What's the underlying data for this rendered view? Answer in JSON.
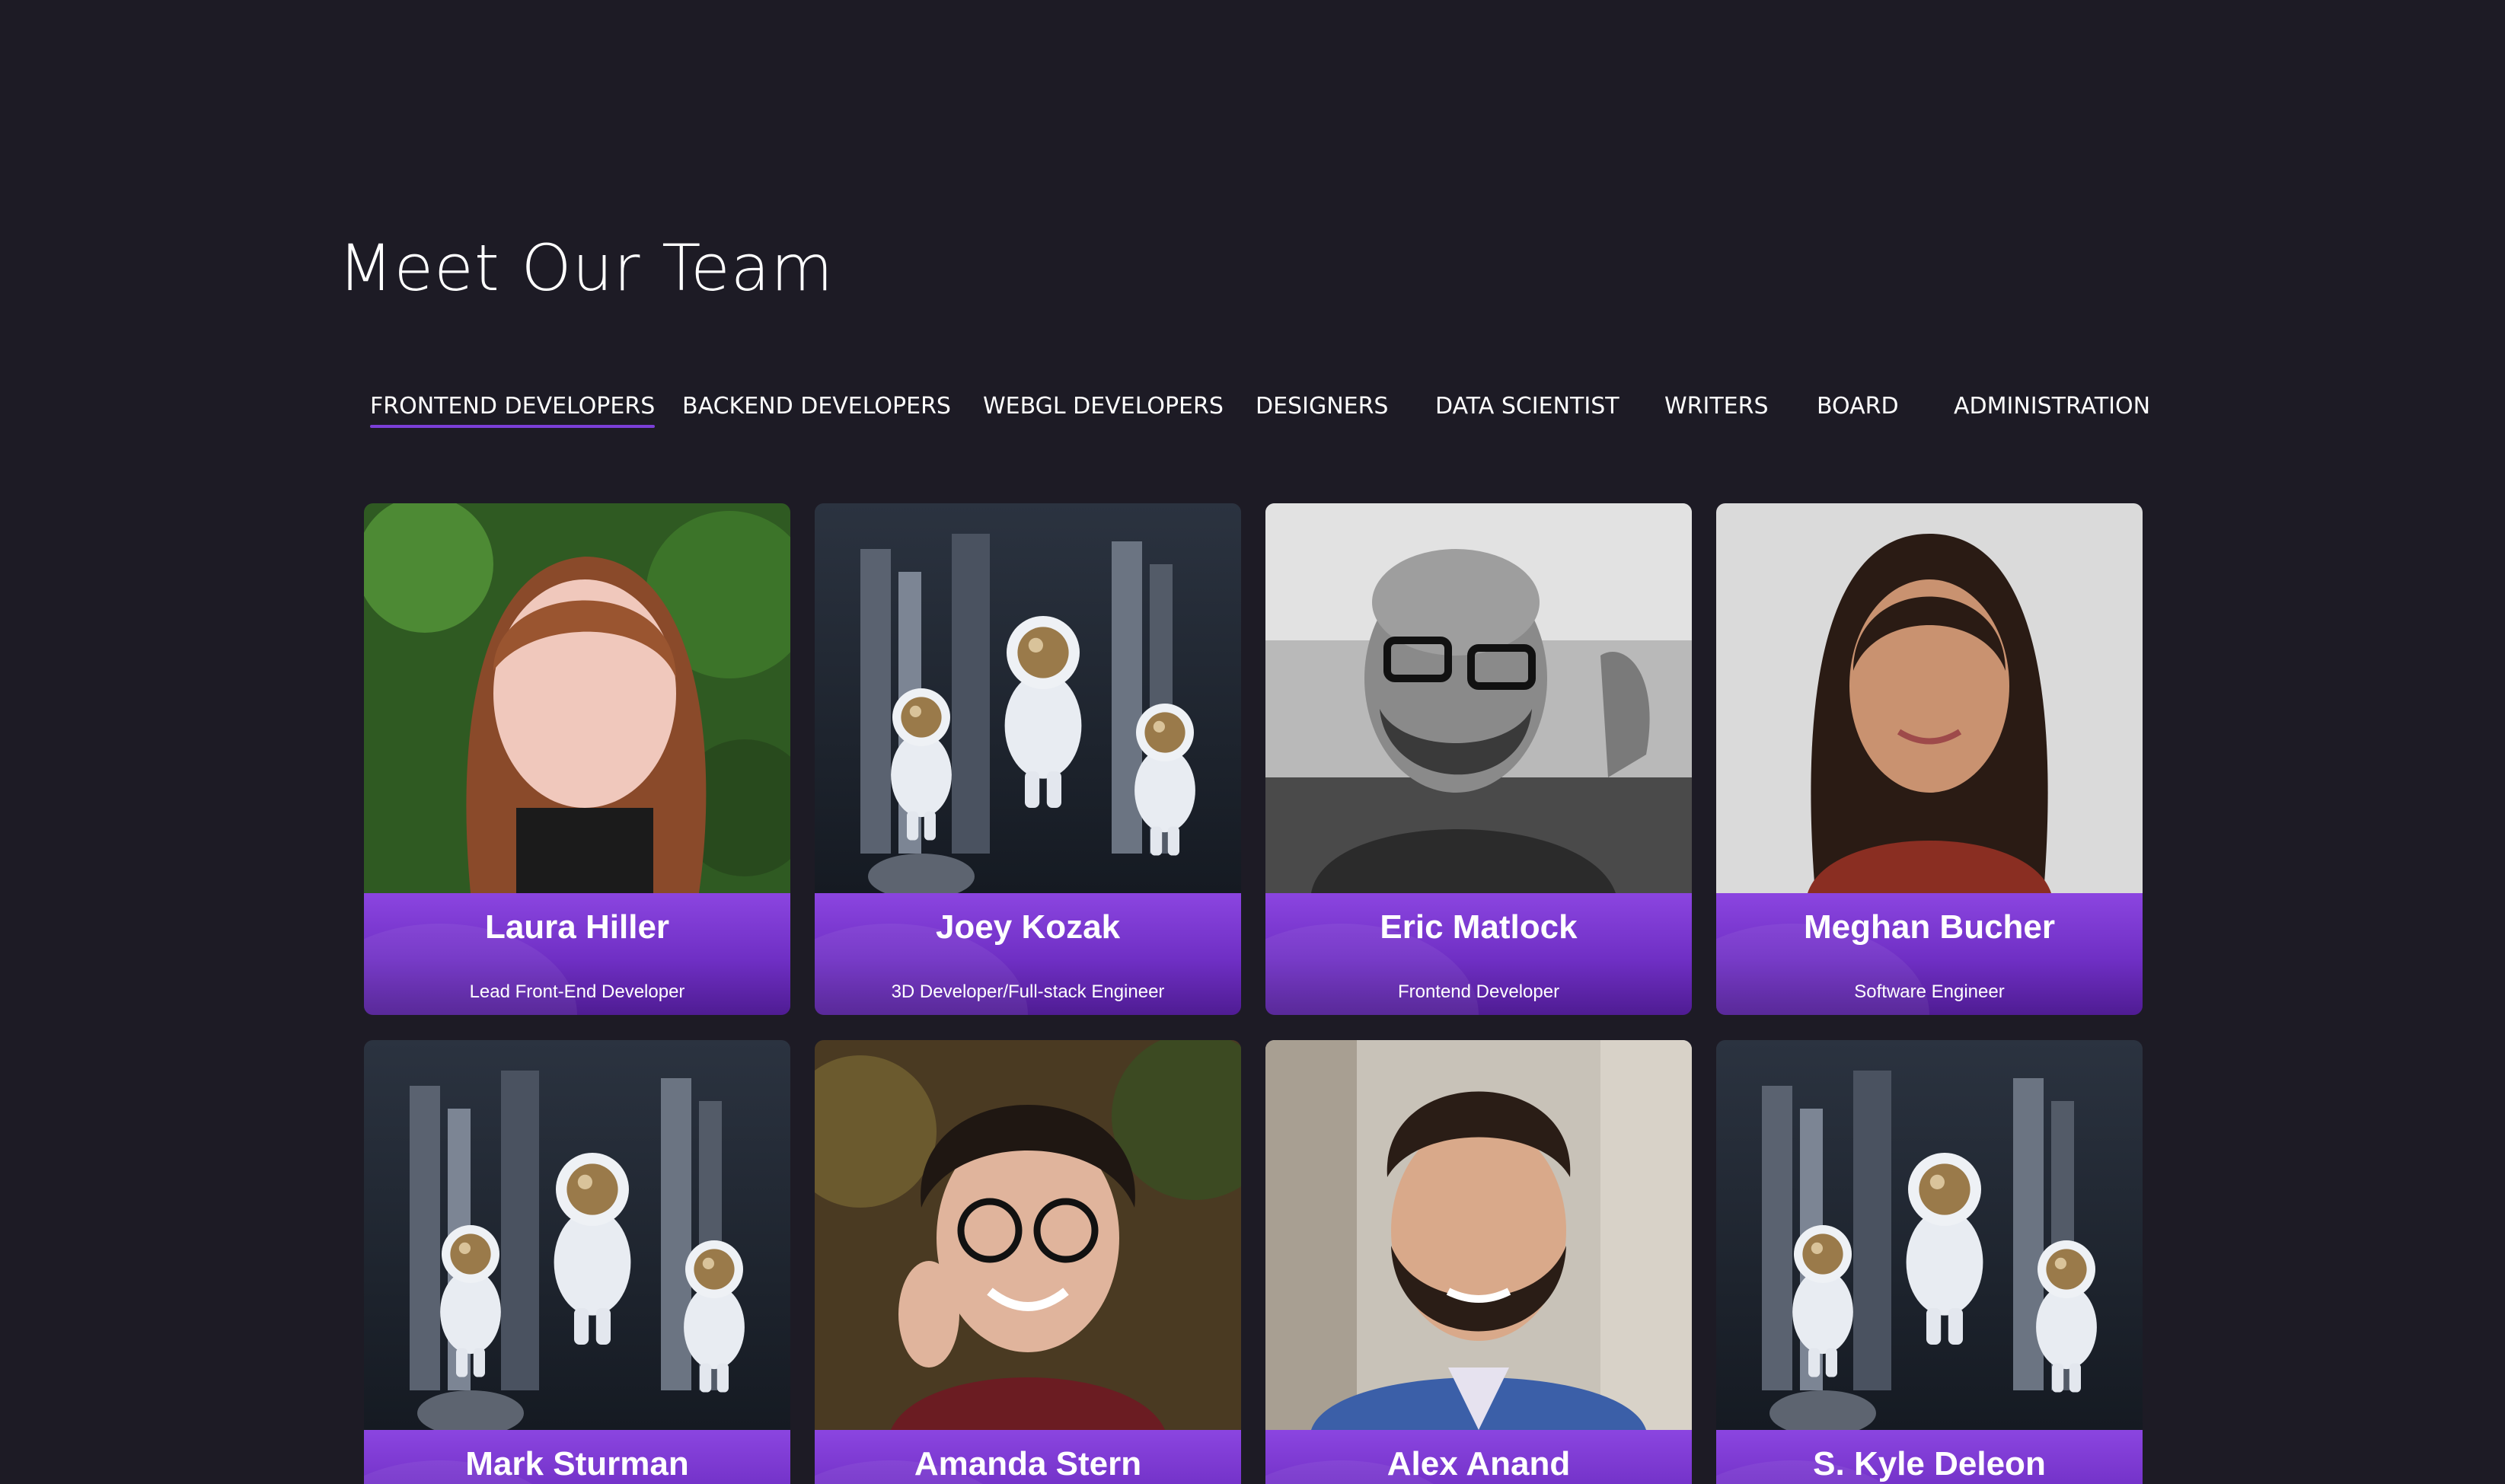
{
  "page": {
    "title": "Meet Our Team"
  },
  "tabs": [
    {
      "label": "FRONTEND DEVELOPERS",
      "active": true
    },
    {
      "label": "BACKEND DEVELOPERS",
      "active": false
    },
    {
      "label": "WEBGL DEVELOPERS",
      "active": false
    },
    {
      "label": "DESIGNERS",
      "active": false
    },
    {
      "label": "DATA SCIENTIST",
      "active": false
    },
    {
      "label": "WRITERS",
      "active": false
    },
    {
      "label": "BOARD",
      "active": false
    },
    {
      "label": "ADMINISTRATION",
      "active": false
    }
  ],
  "team": [
    {
      "name": "Laura Hiller",
      "role": "Lead Front-End Developer",
      "photo": "portrait-photo"
    },
    {
      "name": "Joey Kozak",
      "role": "3D Developer/Full-stack Engineer",
      "photo": "astronaut-figurines-placeholder"
    },
    {
      "name": "Eric Matlock",
      "role": "Frontend Developer",
      "photo": "portrait-photo"
    },
    {
      "name": "Meghan Bucher",
      "role": "Software Engineer",
      "photo": "portrait-photo"
    },
    {
      "name": "Mark Sturman",
      "role": "",
      "photo": "astronaut-figurines-placeholder"
    },
    {
      "name": "Amanda Stern",
      "role": "",
      "photo": "portrait-photo"
    },
    {
      "name": "Alex Anand",
      "role": "",
      "photo": "portrait-photo"
    },
    {
      "name": "S. Kyle Deleon",
      "role": "",
      "photo": "astronaut-figurines-placeholder"
    }
  ],
  "colors": {
    "background": "#1d1b25",
    "accent": "#7b3fd8",
    "caption_top": "#8b45e0",
    "caption_bottom": "#4f1c93",
    "text": "#ffffff"
  }
}
